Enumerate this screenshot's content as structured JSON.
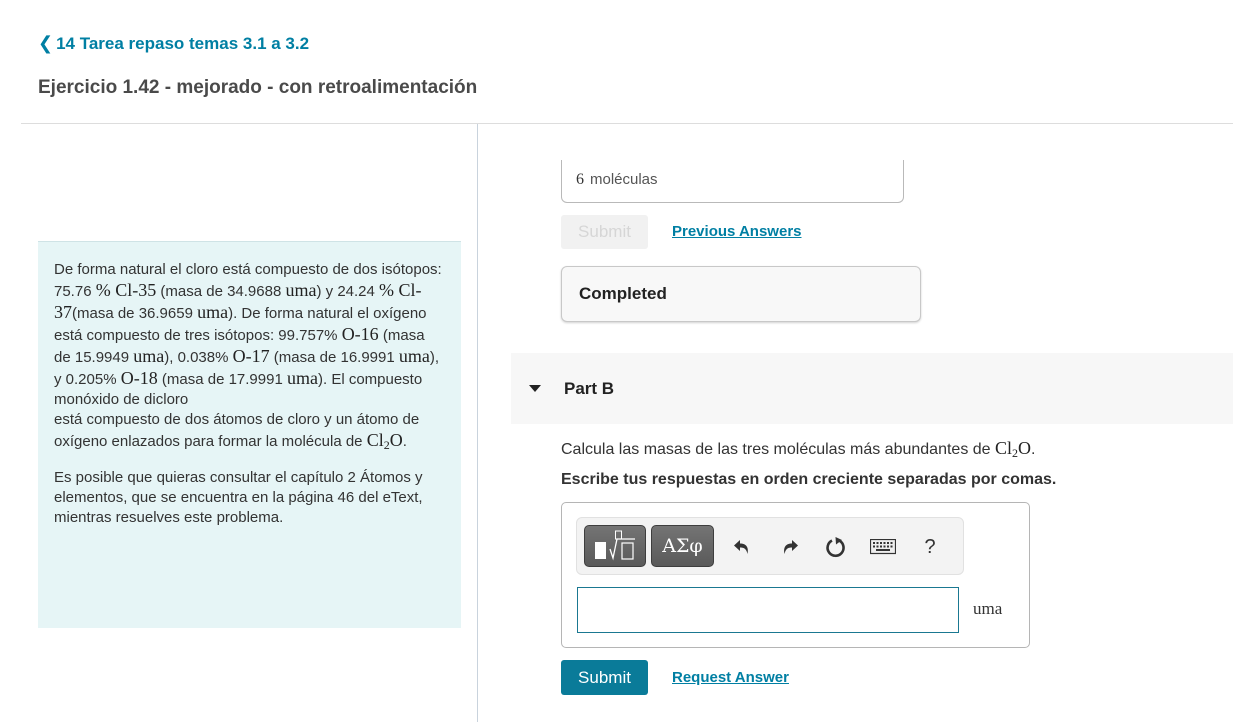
{
  "header": {
    "back_link": "14 Tarea repaso temas 3.1 a 3.2",
    "title": "Ejercicio 1.42 - mejorado - con retroalimentación"
  },
  "intro": {
    "p1": {
      "t1": "De forma natural el cloro está compuesto de dos isótopos: 75.76 ",
      "m1": "% Cl-35",
      "t2": " (masa de 34.9688 ",
      "u1": "uma",
      "t3": ") y 24.24 ",
      "m2": "% Cl-37",
      "t4": "(masa de 36.9659 ",
      "u2": "uma",
      "t5": "). De forma natural el oxígeno está compuesto de tres isótopos: 99.757% ",
      "m3": "O-16",
      "t6": " (masa de 15.9949 ",
      "u3": "uma",
      "t7": "), 0.038% ",
      "m4": "O-17",
      "t8": " (masa de 16.9991 ",
      "u4": "uma",
      "t9": "), y 0.205% ",
      "m5": "O-18",
      "t10": " (masa de 17.9991 ",
      "u5": "uma",
      "t11": "). El compuesto monóxido de dicloro",
      "t12": " está compuesto de dos átomos de cloro y un átomo de oxígeno enlazados para formar la molécula de ",
      "formula_pre": "Cl",
      "formula_sub": "2",
      "formula_post": "O",
      "t13": "."
    },
    "p2": "Es posible que quieras consultar el capítulo 2 Átomos y elementos, que se encuentra en la página 46 del eText, mientras resuelves este problema."
  },
  "part_a": {
    "previous_value_number": "6",
    "previous_value_unit": "moléculas",
    "submit_label": "Submit",
    "previous_answers_link": "Previous Answers",
    "status": "Completed"
  },
  "part_b": {
    "label": "Part B",
    "question_text": "Calcula las masas de las tres moléculas más abundantes de ",
    "formula_pre": "Cl",
    "formula_sub": "2",
    "formula_post": "O",
    "question_end": ".",
    "instruction": "Escribe tus respuestas en orden creciente separadas por comas.",
    "toolbar": {
      "templates_icon": "templates-icon",
      "greek_label": "ΑΣφ",
      "undo_icon": "undo-icon",
      "redo_icon": "redo-icon",
      "reset_icon": "reset-icon",
      "keyboard_icon": "keyboard-icon",
      "help_label": "?"
    },
    "answer_value": "",
    "unit": "uma",
    "submit_label": "Submit",
    "request_answer_link": "Request Answer"
  },
  "colors": {
    "accent": "#007fa3",
    "submit_bg": "#0a7b99",
    "intro_bg": "#e6f5f6"
  }
}
